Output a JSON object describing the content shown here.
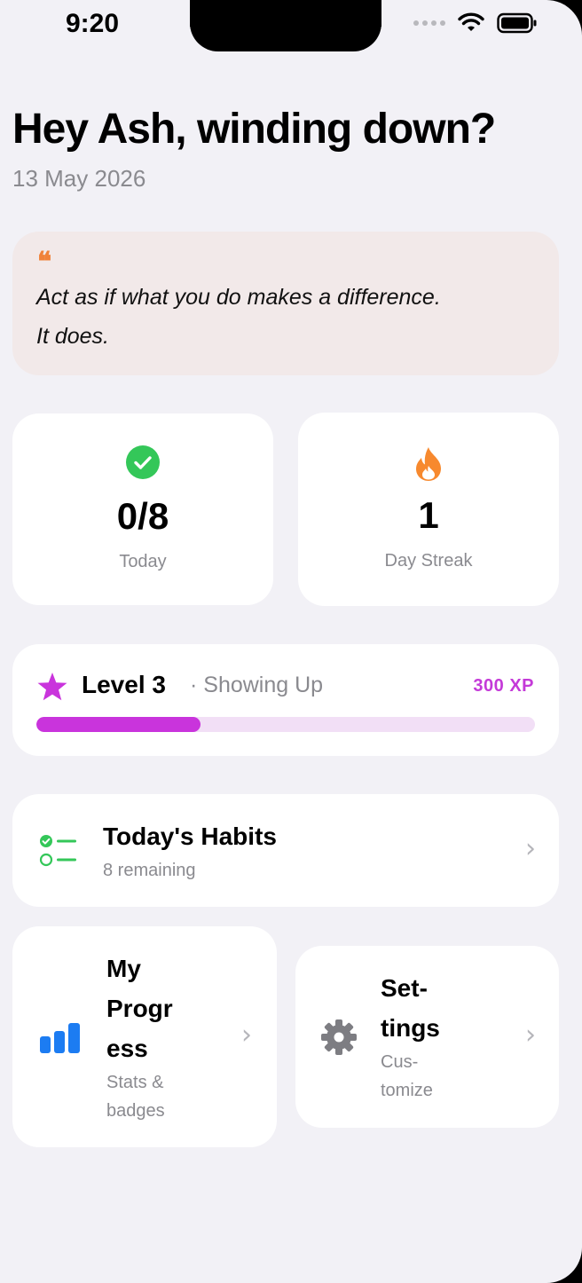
{
  "status_bar": {
    "time": "9:20"
  },
  "header": {
    "greeting": "Hey Ash, winding down?",
    "date": "13 May 2026"
  },
  "quote": {
    "mark": "❝",
    "line1": "Act as if what you do makes a difference.",
    "line2": "It does."
  },
  "stats": {
    "today": {
      "value": "0/8",
      "label": "Today",
      "icon": "checkmark-circle-icon",
      "color": "#34c759"
    },
    "streak": {
      "value": "1",
      "label": "Day Streak",
      "icon": "flame-icon",
      "color": "#f7892e"
    }
  },
  "level": {
    "title": "Level 3",
    "subtitle": "· Showing Up",
    "xp": "300 XP",
    "progress": 0.33,
    "accent": "#c934dc"
  },
  "habits": {
    "title": "Today's Habits",
    "subtitle": "8 remaining",
    "icon": "checklist-icon"
  },
  "my_progress": {
    "title_lines": [
      "My",
      "Progr",
      "ess"
    ],
    "subtitle_lines": [
      "Stats &",
      "badges"
    ],
    "icon": "bar-chart-icon",
    "color": "#1c7cf2"
  },
  "settings": {
    "title_lines": [
      "Set-",
      "tings"
    ],
    "subtitle_lines": [
      "Cus-",
      "tomize"
    ],
    "icon": "gear-icon"
  },
  "chevron": "›"
}
